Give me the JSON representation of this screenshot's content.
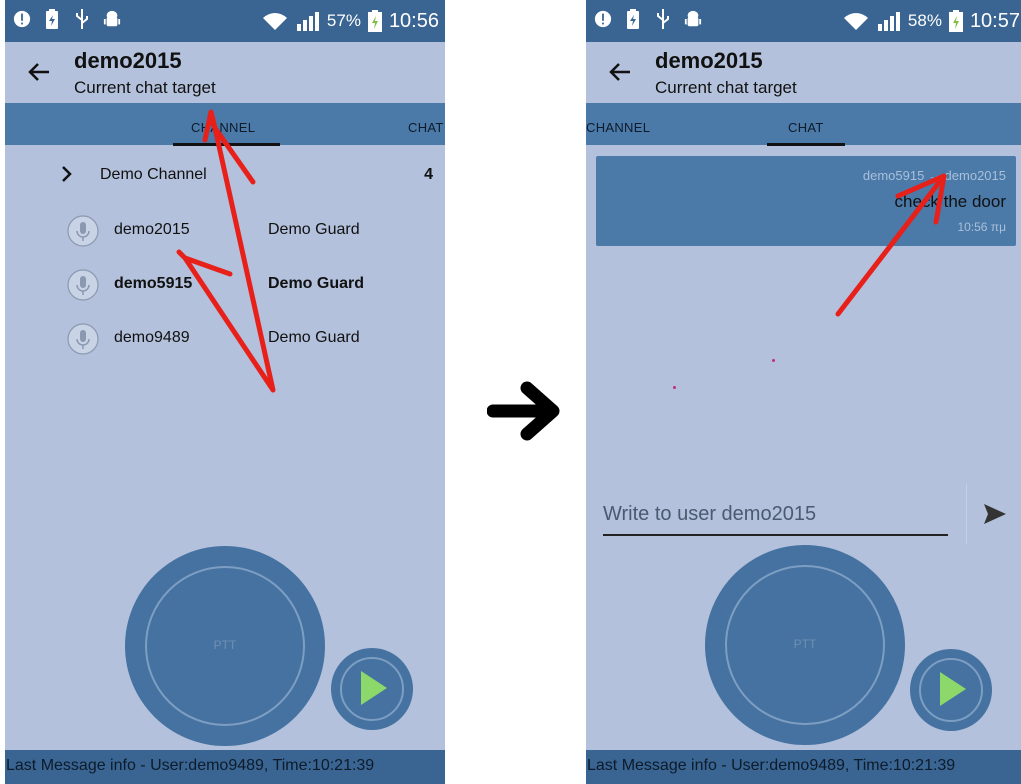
{
  "left": {
    "status": {
      "battery_pct": "57%",
      "time": "10:56"
    },
    "toolbar": {
      "title": "demo2015",
      "subtitle": "Current chat target"
    },
    "tabs": [
      "CHANNEL",
      "CHAT"
    ],
    "channel": {
      "name": "Demo Channel",
      "count": "4"
    },
    "users": [
      {
        "name": "demo2015",
        "role": "Demo Guard"
      },
      {
        "name": "demo5915",
        "role": "Demo Guard"
      },
      {
        "name": "demo9489",
        "role": "Demo Guard"
      }
    ],
    "ptt_label": "PTT",
    "footer": "Last Message info - User:demo9489, Time:10:21:39"
  },
  "right": {
    "status": {
      "battery_pct": "58%",
      "time": "10:57"
    },
    "toolbar": {
      "title": "demo2015",
      "subtitle": "Current chat target"
    },
    "tabs": [
      "CHANNEL",
      "CHAT"
    ],
    "message": {
      "from": "demo5915 → demo2015",
      "text": "check the door",
      "time": "10:56 πμ"
    },
    "compose_placeholder": "Write to user demo2015",
    "ptt_label": "PTT",
    "footer": "Last Message info - User:demo9489, Time:10:21:39"
  },
  "colors": {
    "status_bar": "#3a6592",
    "background": "#b3c1dc",
    "tab_bar": "#4b79a8",
    "button": "#4572a1",
    "annotation": "#e8201a"
  },
  "icons": [
    "alert-icon",
    "battery-saver-icon",
    "usb-icon",
    "android-debug-icon",
    "wifi-icon",
    "signal-icon",
    "battery-icon",
    "back-arrow-icon",
    "chevron-right-icon",
    "microphone-icon",
    "send-icon",
    "play-icon"
  ]
}
